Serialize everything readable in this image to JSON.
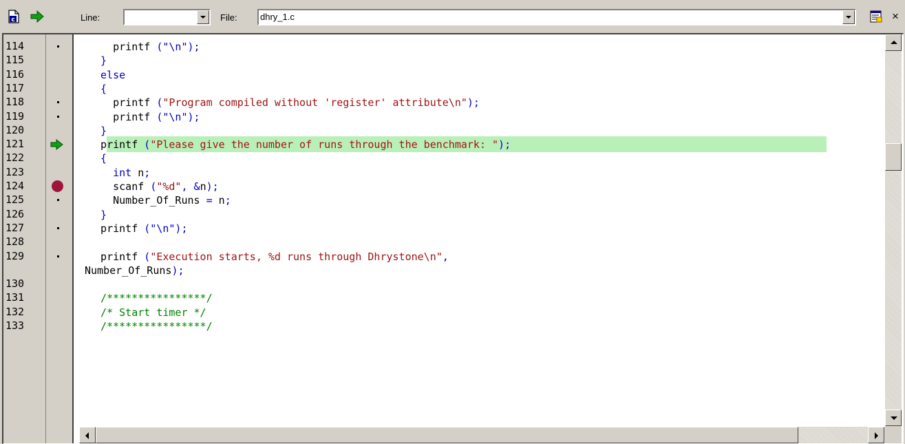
{
  "toolbar": {
    "line_label": "Line:",
    "line_value": "",
    "file_label": "File:",
    "file_value": "dhry_1.c",
    "icons": [
      "c-file-icon",
      "go-arrow-icon",
      "properties-icon",
      "close-icon"
    ],
    "close_glyph": "×"
  },
  "editor": {
    "colors": {
      "keyword": "#0000c0",
      "string": "#a01414",
      "comment": "#008000",
      "highlight": "#b9f0b9",
      "breakpoint": "#a0143c",
      "arrow": "#10a010"
    },
    "current_line": "121",
    "breakpoint_line": "124",
    "rows": [
      {
        "ln": "114",
        "mark": "dot",
        "segs": [
          {
            "t": "    printf ",
            "c": "plain"
          },
          {
            "t": "(\"\\n\");",
            "c": "pn"
          }
        ]
      },
      {
        "ln": "115",
        "mark": "",
        "segs": [
          {
            "t": "  }",
            "c": "pn"
          }
        ]
      },
      {
        "ln": "116",
        "mark": "",
        "segs": [
          {
            "t": "  else",
            "c": "kw"
          }
        ]
      },
      {
        "ln": "117",
        "mark": "",
        "segs": [
          {
            "t": "  {",
            "c": "pn"
          }
        ]
      },
      {
        "ln": "118",
        "mark": "dot",
        "segs": [
          {
            "t": "    printf ",
            "c": "plain"
          },
          {
            "t": "(",
            "c": "pn"
          },
          {
            "t": "\"Program compiled without 'register' attribute\\n\"",
            "c": "str"
          },
          {
            "t": ");",
            "c": "pn"
          }
        ]
      },
      {
        "ln": "119",
        "mark": "dot",
        "segs": [
          {
            "t": "    printf ",
            "c": "plain"
          },
          {
            "t": "(\"\\n\");",
            "c": "pn"
          }
        ]
      },
      {
        "ln": "120",
        "mark": "",
        "segs": [
          {
            "t": "  }",
            "c": "pn"
          }
        ]
      },
      {
        "ln": "121",
        "mark": "arrow",
        "segs": [
          {
            "t": "  printf ",
            "c": "plain"
          },
          {
            "t": "(",
            "c": "pn"
          },
          {
            "t": "\"Please give the number of runs through the benchmark: \"",
            "c": "str"
          },
          {
            "t": ");",
            "c": "pn"
          }
        ]
      },
      {
        "ln": "122",
        "mark": "",
        "segs": [
          {
            "t": "  {",
            "c": "pn"
          }
        ]
      },
      {
        "ln": "123",
        "mark": "",
        "segs": [
          {
            "t": "    int ",
            "c": "kw"
          },
          {
            "t": "n",
            "c": "plain"
          },
          {
            "t": ";",
            "c": "pn"
          }
        ]
      },
      {
        "ln": "124",
        "mark": "bp",
        "segs": [
          {
            "t": "    scanf ",
            "c": "plain"
          },
          {
            "t": "(",
            "c": "pn"
          },
          {
            "t": "\"%d\"",
            "c": "str"
          },
          {
            "t": ", &",
            "c": "pn"
          },
          {
            "t": "n",
            "c": "plain"
          },
          {
            "t": ");",
            "c": "pn"
          }
        ]
      },
      {
        "ln": "125",
        "mark": "dot",
        "segs": [
          {
            "t": "    Number_Of_Runs ",
            "c": "plain"
          },
          {
            "t": "= ",
            "c": "pn"
          },
          {
            "t": "n",
            "c": "plain"
          },
          {
            "t": ";",
            "c": "pn"
          }
        ]
      },
      {
        "ln": "126",
        "mark": "",
        "segs": [
          {
            "t": "  }",
            "c": "pn"
          }
        ]
      },
      {
        "ln": "127",
        "mark": "dot",
        "segs": [
          {
            "t": "  printf ",
            "c": "plain"
          },
          {
            "t": "(\"\\n\");",
            "c": "pn"
          }
        ]
      },
      {
        "ln": "128",
        "mark": "",
        "segs": []
      },
      {
        "ln": "129",
        "mark": "dot",
        "segs": [
          {
            "t": "  printf ",
            "c": "plain"
          },
          {
            "t": "(",
            "c": "pn"
          },
          {
            "t": "\"Execution starts, %d runs through Dhrystone\\n\"",
            "c": "str"
          },
          {
            "t": ",",
            "c": "pn"
          }
        ]
      },
      {
        "ln": "",
        "mark": "",
        "segs": [
          {
            "t": "Number_Of_Runs",
            "c": "plain"
          },
          {
            "t": ");",
            "c": "pn"
          }
        ]
      },
      {
        "ln": "130",
        "mark": "",
        "segs": []
      },
      {
        "ln": "131",
        "mark": "",
        "segs": [
          {
            "t": "  /****************/",
            "c": "cmt"
          }
        ]
      },
      {
        "ln": "132",
        "mark": "",
        "segs": [
          {
            "t": "  /* Start timer */",
            "c": "cmt"
          }
        ]
      },
      {
        "ln": "133",
        "mark": "",
        "segs": [
          {
            "t": "  /****************/",
            "c": "cmt"
          }
        ]
      }
    ]
  }
}
